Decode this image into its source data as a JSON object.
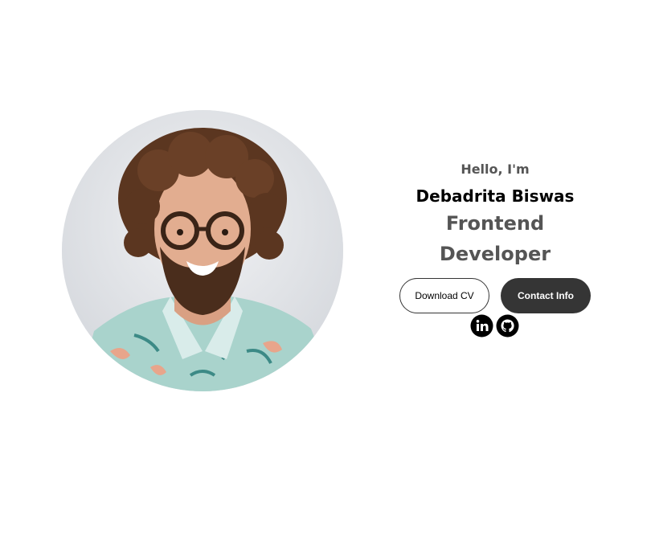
{
  "profile": {
    "image_description": "smiling man with curly hair and glasses wearing a floral shirt"
  },
  "hero": {
    "greeting": "Hello, I'm",
    "name": "Debadrita Biswas",
    "job_title_line1": "Frontend",
    "job_title_line2": "Developer"
  },
  "buttons": {
    "download_cv": "Download CV",
    "contact_info": "Contact Info"
  },
  "socials": [
    {
      "icon": "linkedin-icon"
    },
    {
      "icon": "github-icon"
    }
  ],
  "colors": {
    "background": "#ffffff",
    "text_primary": "#000000",
    "text_secondary": "#555555",
    "button_dark": "#353535"
  }
}
